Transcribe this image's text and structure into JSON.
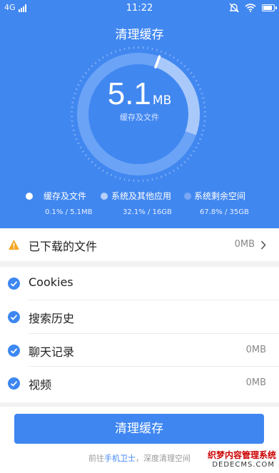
{
  "status_bar": {
    "network": "4G",
    "time": "11:22"
  },
  "header": {
    "title": "清理缓存"
  },
  "summary": {
    "value": "5.1",
    "unit": "MB",
    "caption": "缓存及文件",
    "ring_fraction": 0.25
  },
  "legend": [
    {
      "label": "缓存及文件",
      "value": "0.1% / 5.1MB",
      "color": "#ffffff"
    },
    {
      "label": "系统及其他应用",
      "value": "32.1% / 16GB",
      "color": "#b7d0f9"
    },
    {
      "label": "系统剩余空间",
      "value": "67.8% / 35GB",
      "color": "#7aa8f3"
    }
  ],
  "downloads": {
    "label": "已下载的文件",
    "size": "0MB"
  },
  "items": [
    {
      "label": "Cookies",
      "size": ""
    },
    {
      "label": "搜索历史",
      "size": ""
    },
    {
      "label": "聊天记录",
      "size": "0MB"
    },
    {
      "label": "视频",
      "size": "0MB"
    }
  ],
  "action": {
    "label": "清理缓存"
  },
  "footer": {
    "prefix": "前往",
    "link": "手机卫士",
    "suffix": "，深度清理空间"
  },
  "watermark": {
    "line1": "织梦内容管理系统",
    "line2": "DEDECMS.COM"
  }
}
